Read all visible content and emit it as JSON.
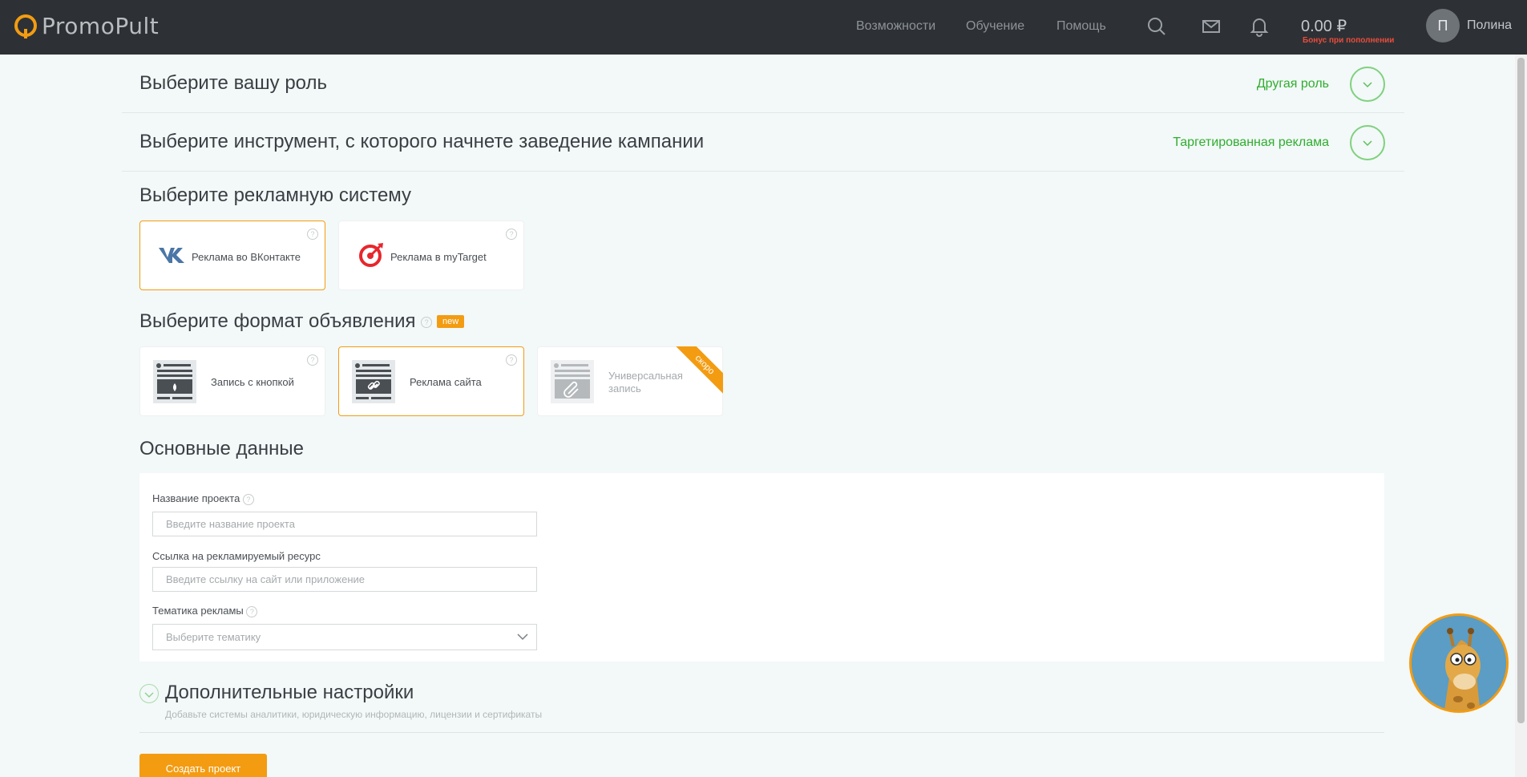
{
  "header": {
    "logo_text": "PromoPult",
    "nav": [
      "Возможности",
      "Обучение",
      "Помощь"
    ],
    "balance": "0.00 ₽",
    "bonus": "Бонус при пополнении",
    "avatar_letter": "П",
    "username": "Полина"
  },
  "role_row": {
    "title": "Выберите вашу роль",
    "value": "Другая роль"
  },
  "tool_row": {
    "title": "Выберите инструмент, с которого начнете заведение кампании",
    "value": "Таргетированная реклама"
  },
  "ad_system": {
    "title": "Выберите рекламную систему",
    "options": [
      {
        "label": "Реклама во ВКонтакте",
        "selected": true
      },
      {
        "label": "Реклама в myTarget",
        "selected": false
      }
    ]
  },
  "ad_format": {
    "title": "Выберите формат объявления",
    "badge": "new",
    "options": [
      {
        "label": "Запись с кнопкой",
        "selected": false
      },
      {
        "label": "Реклама сайта",
        "selected": true
      },
      {
        "label_line1": "Универсальная",
        "label_line2": "запись",
        "ribbon": "скоро"
      }
    ]
  },
  "basic_data": {
    "title": "Основные данные",
    "project_name": {
      "label": "Название проекта",
      "placeholder": "Введите название проекта"
    },
    "resource_link": {
      "label": "Ссылка на рекламируемый ресурс",
      "placeholder": "Введите ссылку на сайт или приложение"
    },
    "topic": {
      "label": "Тематика рекламы",
      "placeholder": "Выберите тематику"
    }
  },
  "extra": {
    "title": "Дополнительные настройки",
    "subtitle": "Добавьте системы аналитики, юридическую информацию, лицензии и сертификаты"
  },
  "create_button": "Создать проект",
  "colors": {
    "accent": "#f39c12",
    "green": "#2fae2f",
    "header_bg": "#2d3135"
  },
  "icons": [
    "search-icon",
    "mail-icon",
    "bell-icon",
    "chevron-down-icon",
    "help-icon",
    "vk-icon",
    "mytarget-icon"
  ]
}
